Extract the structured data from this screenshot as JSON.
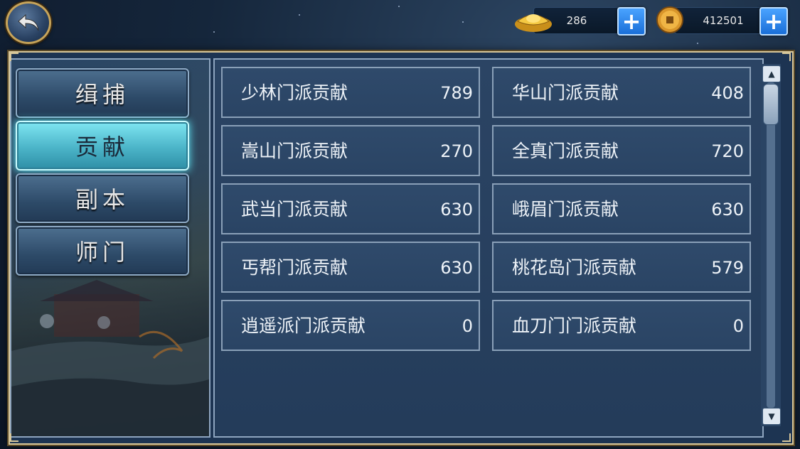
{
  "currencies": {
    "gold_ingot": {
      "icon": "gold-ingot-icon",
      "value": "286"
    },
    "coin": {
      "icon": "copper-coin-icon",
      "value": "412501"
    }
  },
  "tabs": [
    {
      "label": "缉捕",
      "active": false
    },
    {
      "label": "贡献",
      "active": true
    },
    {
      "label": "副本",
      "active": false
    },
    {
      "label": "师门",
      "active": false
    }
  ],
  "contributions": [
    {
      "name": "少林门派贡献",
      "value": "789"
    },
    {
      "name": "华山门派贡献",
      "value": "408"
    },
    {
      "name": "嵩山门派贡献",
      "value": "270"
    },
    {
      "name": "全真门派贡献",
      "value": "720"
    },
    {
      "name": "武当门派贡献",
      "value": "630"
    },
    {
      "name": "峨眉门派贡献",
      "value": "630"
    },
    {
      "name": "丐帮门派贡献",
      "value": "630"
    },
    {
      "name": "桃花岛门派贡献",
      "value": "579"
    },
    {
      "name": "逍遥派门派贡献",
      "value": "0"
    },
    {
      "name": "血刀门门派贡献",
      "value": "0"
    }
  ],
  "colors": {
    "accent_active_tab": "#4bb4c8",
    "frame_gold": "#d8c79a",
    "panel_bg": "#243c5a"
  }
}
